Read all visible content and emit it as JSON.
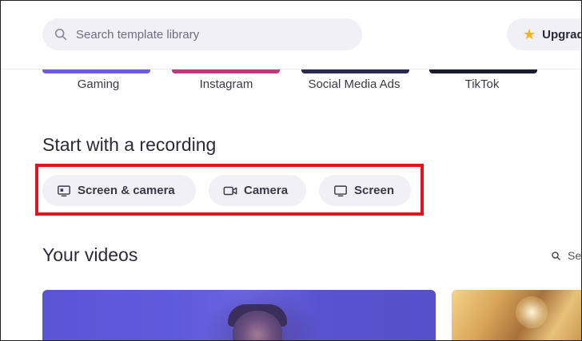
{
  "header": {
    "search_placeholder": "Search template library",
    "upgrade_label": "Upgrade"
  },
  "templates": {
    "items": [
      {
        "label": "Gaming",
        "color": "#6c5ce7"
      },
      {
        "label": "Instagram",
        "color": "#c0397a"
      },
      {
        "label": "Social Media Ads",
        "color": "#2a2a55"
      },
      {
        "label": "TikTok",
        "color": "#1b1b2e"
      }
    ]
  },
  "recording": {
    "title": "Start with a recording",
    "buttons": [
      {
        "label": "Screen & camera",
        "icon": "screen-camera-icon"
      },
      {
        "label": "Camera",
        "icon": "video-camera-icon"
      },
      {
        "label": "Screen",
        "icon": "monitor-icon"
      }
    ],
    "highlight_color": "#e0141e"
  },
  "videos": {
    "title": "Your videos",
    "search_label": "Se"
  },
  "colors": {
    "pill_bg": "#f1f0f6",
    "accent_star": "#f5b400"
  }
}
